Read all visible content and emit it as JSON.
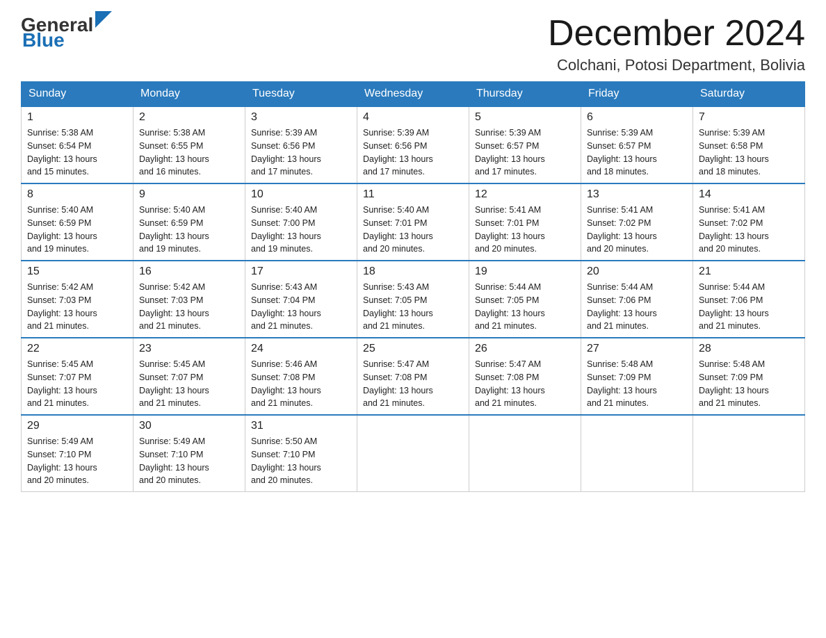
{
  "logo": {
    "general": "General",
    "triangle": "",
    "blue": "Blue"
  },
  "header": {
    "month_title": "December 2024",
    "location": "Colchani, Potosi Department, Bolivia"
  },
  "weekdays": [
    "Sunday",
    "Monday",
    "Tuesday",
    "Wednesday",
    "Thursday",
    "Friday",
    "Saturday"
  ],
  "weeks": [
    [
      {
        "day": "1",
        "sunrise": "5:38 AM",
        "sunset": "6:54 PM",
        "daylight": "13 hours and 15 minutes."
      },
      {
        "day": "2",
        "sunrise": "5:38 AM",
        "sunset": "6:55 PM",
        "daylight": "13 hours and 16 minutes."
      },
      {
        "day": "3",
        "sunrise": "5:39 AM",
        "sunset": "6:56 PM",
        "daylight": "13 hours and 17 minutes."
      },
      {
        "day": "4",
        "sunrise": "5:39 AM",
        "sunset": "6:56 PM",
        "daylight": "13 hours and 17 minutes."
      },
      {
        "day": "5",
        "sunrise": "5:39 AM",
        "sunset": "6:57 PM",
        "daylight": "13 hours and 17 minutes."
      },
      {
        "day": "6",
        "sunrise": "5:39 AM",
        "sunset": "6:57 PM",
        "daylight": "13 hours and 18 minutes."
      },
      {
        "day": "7",
        "sunrise": "5:39 AM",
        "sunset": "6:58 PM",
        "daylight": "13 hours and 18 minutes."
      }
    ],
    [
      {
        "day": "8",
        "sunrise": "5:40 AM",
        "sunset": "6:59 PM",
        "daylight": "13 hours and 19 minutes."
      },
      {
        "day": "9",
        "sunrise": "5:40 AM",
        "sunset": "6:59 PM",
        "daylight": "13 hours and 19 minutes."
      },
      {
        "day": "10",
        "sunrise": "5:40 AM",
        "sunset": "7:00 PM",
        "daylight": "13 hours and 19 minutes."
      },
      {
        "day": "11",
        "sunrise": "5:40 AM",
        "sunset": "7:01 PM",
        "daylight": "13 hours and 20 minutes."
      },
      {
        "day": "12",
        "sunrise": "5:41 AM",
        "sunset": "7:01 PM",
        "daylight": "13 hours and 20 minutes."
      },
      {
        "day": "13",
        "sunrise": "5:41 AM",
        "sunset": "7:02 PM",
        "daylight": "13 hours and 20 minutes."
      },
      {
        "day": "14",
        "sunrise": "5:41 AM",
        "sunset": "7:02 PM",
        "daylight": "13 hours and 20 minutes."
      }
    ],
    [
      {
        "day": "15",
        "sunrise": "5:42 AM",
        "sunset": "7:03 PM",
        "daylight": "13 hours and 21 minutes."
      },
      {
        "day": "16",
        "sunrise": "5:42 AM",
        "sunset": "7:03 PM",
        "daylight": "13 hours and 21 minutes."
      },
      {
        "day": "17",
        "sunrise": "5:43 AM",
        "sunset": "7:04 PM",
        "daylight": "13 hours and 21 minutes."
      },
      {
        "day": "18",
        "sunrise": "5:43 AM",
        "sunset": "7:05 PM",
        "daylight": "13 hours and 21 minutes."
      },
      {
        "day": "19",
        "sunrise": "5:44 AM",
        "sunset": "7:05 PM",
        "daylight": "13 hours and 21 minutes."
      },
      {
        "day": "20",
        "sunrise": "5:44 AM",
        "sunset": "7:06 PM",
        "daylight": "13 hours and 21 minutes."
      },
      {
        "day": "21",
        "sunrise": "5:44 AM",
        "sunset": "7:06 PM",
        "daylight": "13 hours and 21 minutes."
      }
    ],
    [
      {
        "day": "22",
        "sunrise": "5:45 AM",
        "sunset": "7:07 PM",
        "daylight": "13 hours and 21 minutes."
      },
      {
        "day": "23",
        "sunrise": "5:45 AM",
        "sunset": "7:07 PM",
        "daylight": "13 hours and 21 minutes."
      },
      {
        "day": "24",
        "sunrise": "5:46 AM",
        "sunset": "7:08 PM",
        "daylight": "13 hours and 21 minutes."
      },
      {
        "day": "25",
        "sunrise": "5:47 AM",
        "sunset": "7:08 PM",
        "daylight": "13 hours and 21 minutes."
      },
      {
        "day": "26",
        "sunrise": "5:47 AM",
        "sunset": "7:08 PM",
        "daylight": "13 hours and 21 minutes."
      },
      {
        "day": "27",
        "sunrise": "5:48 AM",
        "sunset": "7:09 PM",
        "daylight": "13 hours and 21 minutes."
      },
      {
        "day": "28",
        "sunrise": "5:48 AM",
        "sunset": "7:09 PM",
        "daylight": "13 hours and 21 minutes."
      }
    ],
    [
      {
        "day": "29",
        "sunrise": "5:49 AM",
        "sunset": "7:10 PM",
        "daylight": "13 hours and 20 minutes."
      },
      {
        "day": "30",
        "sunrise": "5:49 AM",
        "sunset": "7:10 PM",
        "daylight": "13 hours and 20 minutes."
      },
      {
        "day": "31",
        "sunrise": "5:50 AM",
        "sunset": "7:10 PM",
        "daylight": "13 hours and 20 minutes."
      },
      null,
      null,
      null,
      null
    ]
  ],
  "labels": {
    "sunrise": "Sunrise:",
    "sunset": "Sunset:",
    "daylight": "Daylight:"
  }
}
